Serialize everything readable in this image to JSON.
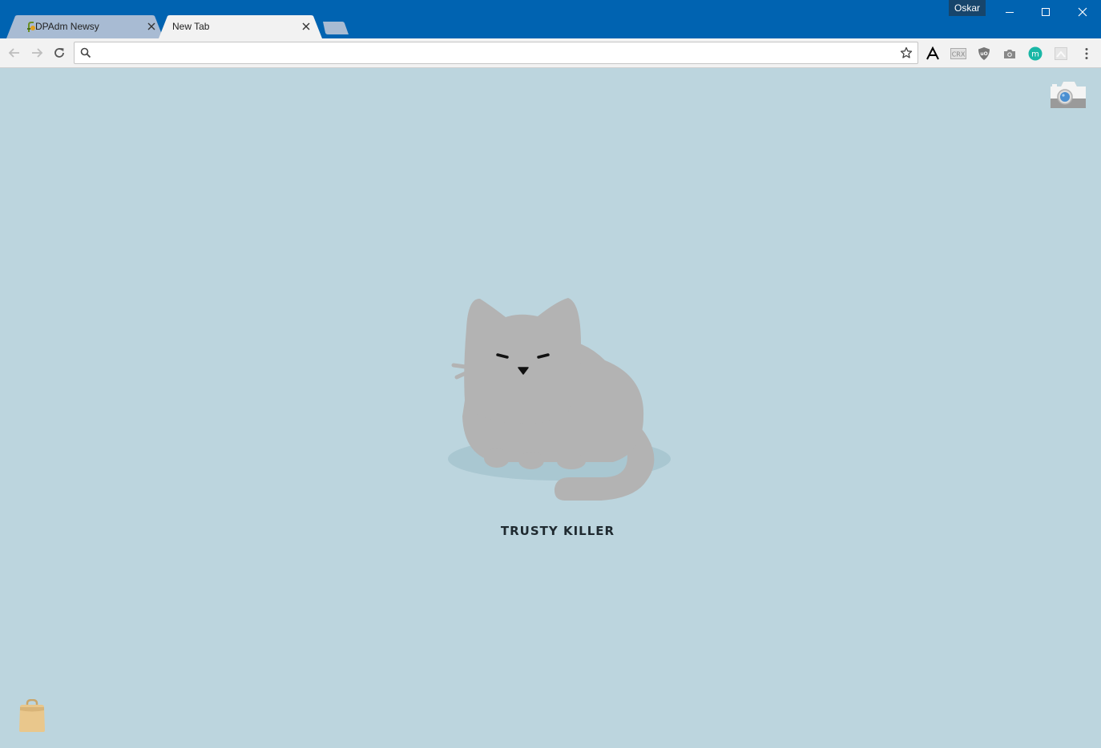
{
  "window": {
    "profile_name": "Oskar",
    "controls": [
      "minimize-icon",
      "maximize-icon",
      "close-icon"
    ]
  },
  "tabs": [
    {
      "title": "DPAdm Newsy",
      "active": false,
      "favicon": "dpadm-favicon"
    },
    {
      "title": "New Tab",
      "active": true
    }
  ],
  "toolbar": {
    "omnibox_value": "",
    "omnibox_placeholder": "",
    "extensions": [
      "font-a-icon",
      "crx-icon",
      "ublock-shield-icon",
      "camera-icon",
      "m-extension-icon",
      "blank-extension-icon"
    ],
    "crx_label": "CRX",
    "m_label": "m"
  },
  "content": {
    "pet_name": "TRUSTY KILLER"
  },
  "colors": {
    "titlebar": "#0063b1",
    "page_background": "#bcd5de",
    "cat_fur": "#b3b3b3",
    "bag": "#e9c78c",
    "m_extension": "#1ab7a6"
  }
}
